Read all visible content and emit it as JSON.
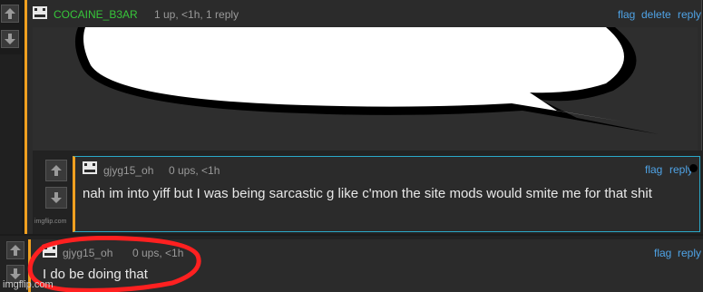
{
  "comment1": {
    "username": "COCAINE_B3AR",
    "meta": "1 up, <1h, 1 reply",
    "actions": [
      "flag",
      "delete",
      "reply"
    ],
    "username_color": "#37c63a",
    "image_alt": "speech bubble image"
  },
  "comment2": {
    "username": "gjyg15_oh",
    "meta": "0 ups, <1h",
    "actions": [
      "flag",
      "reply"
    ],
    "text": "nah im into yiff but I was being sarcastic g like c'mon the site mods would smite me for that shit",
    "watermark": "imgflip.com"
  },
  "comment3": {
    "username": "gjyg15_oh",
    "meta": "0 ups, <1h",
    "actions": [
      "flag",
      "reply"
    ],
    "text": "I do be doing that"
  },
  "watermark": "imgflip.com",
  "colors": {
    "accent_orange": "#f0a020",
    "link_blue": "#4fa3e6",
    "highlight_cyan": "#2aa9c9",
    "annotation_red": "#ff2020"
  }
}
